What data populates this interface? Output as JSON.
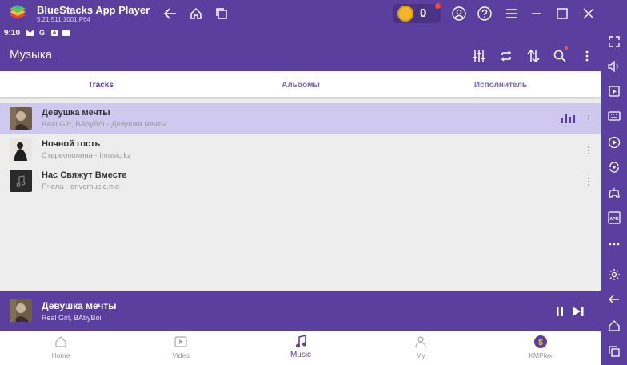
{
  "window": {
    "app_title": "BlueStacks App Player",
    "version": "5.21.511.1001 P64",
    "coins": "0",
    "icons": [
      "back-icon",
      "home-icon",
      "multitask-icon",
      "account-icon",
      "help-icon",
      "menu-icon",
      "minimize-icon",
      "maximize-icon",
      "close-icon"
    ]
  },
  "status_bar": {
    "time": "9:10",
    "icons": [
      "notification-m-icon",
      "google-g-icon",
      "notification-a-icon",
      "card-icon"
    ]
  },
  "app_bar": {
    "title": "Музыка",
    "actions": [
      "equalizer-icon",
      "repeat-icon",
      "sort-icon",
      "search-icon",
      "overflow-menu-icon"
    ]
  },
  "tabs": [
    {
      "label": "Tracks",
      "active": true
    },
    {
      "label": "Альбомы",
      "active": false
    },
    {
      "label": "Исполнитель",
      "active": false
    }
  ],
  "tracks": [
    {
      "title": "Девушка мечты",
      "subtitle": "Real Girl, BAbyBoi - Девушка мечты",
      "playing": true
    },
    {
      "title": "Ночной гость",
      "subtitle": "Стереополина - Imusic.kz",
      "playing": false
    },
    {
      "title": "Нас Свяжут Вместе",
      "subtitle": "Пчела - drivemusic.me",
      "playing": false
    }
  ],
  "now_playing": {
    "title": "Девушка мечты",
    "subtitle": "Real Girl, BAbyBoi"
  },
  "bottom_nav": [
    {
      "label": "Home",
      "icon": "home-icon",
      "active": false
    },
    {
      "label": "Video",
      "icon": "video-icon",
      "active": false
    },
    {
      "label": "Music",
      "icon": "music-note-icon",
      "active": true
    },
    {
      "label": "My",
      "icon": "person-icon",
      "active": false
    },
    {
      "label": "KMPlex",
      "icon": "kmplex-coin-icon",
      "active": false
    }
  ],
  "colors": {
    "primary": "#5b3f9e",
    "playing_row": "#cfc8ef",
    "background": "#ededed"
  }
}
